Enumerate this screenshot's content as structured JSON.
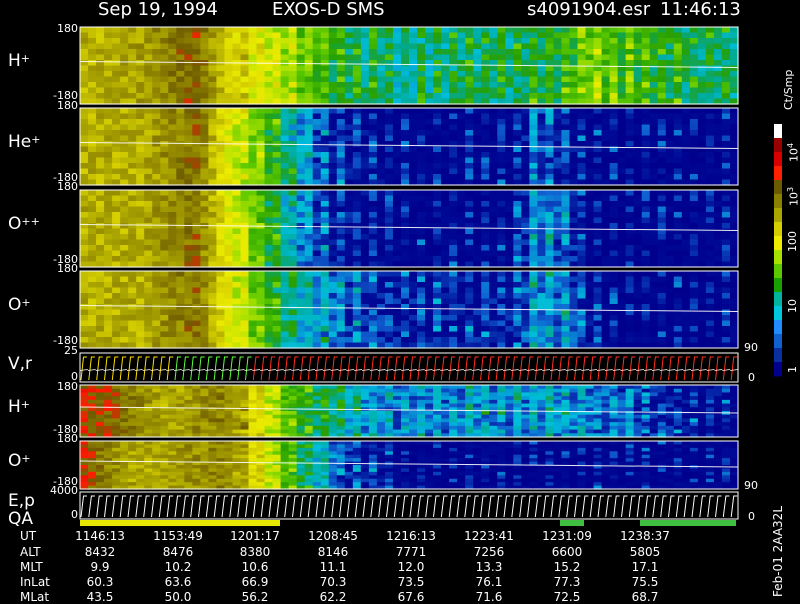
{
  "header": {
    "date": "Sep 19, 1994",
    "instrument": "EXOS-D SMS",
    "file": "s4091904.esr",
    "time": "11:46:13"
  },
  "panels": [
    {
      "id": "h-plus",
      "label": "H",
      "sup": "+",
      "top": "180",
      "bottom": "-180"
    },
    {
      "id": "he-plus",
      "label": "He",
      "sup": "+",
      "top": "180",
      "bottom": "-180"
    },
    {
      "id": "o-plusplus",
      "label": "O",
      "sup": "++",
      "top": "180",
      "bottom": "-180"
    },
    {
      "id": "o-plus",
      "label": "O",
      "sup": "+",
      "top": "180",
      "bottom": "-180"
    },
    {
      "id": "vr",
      "label": "V,r",
      "sup": "",
      "top": "25",
      "bottom": "0"
    },
    {
      "id": "h-plus-2",
      "label": "H",
      "sup": "+",
      "top": "180",
      "bottom": "-180"
    },
    {
      "id": "o-plus-2",
      "label": "O",
      "sup": "+",
      "top": "180",
      "bottom": "-180"
    },
    {
      "id": "ep",
      "label": "E,p",
      "sup": "",
      "top": "4000",
      "bottom": "0"
    }
  ],
  "qa_label": "QA",
  "right_ticks": {
    "vr_top": "90",
    "vr_bottom": "0",
    "ep_top": "90",
    "ep_bottom": "0"
  },
  "colorbar": {
    "unit": "Ct/Smp",
    "labels": [
      {
        "base": "10",
        "exp": "4"
      },
      {
        "base": "10",
        "exp": "3"
      },
      {
        "base": "100",
        "exp": ""
      },
      {
        "base": "10",
        "exp": ""
      },
      {
        "base": "1",
        "exp": ""
      }
    ],
    "colors": [
      "#ffffff",
      "#9a0000",
      "#d80000",
      "#ff2000",
      "#6c5a00",
      "#8c8000",
      "#aca600",
      "#d4d000",
      "#eeee00",
      "#a8e000",
      "#5cc800",
      "#18a000",
      "#00b4a0",
      "#00c8dc",
      "#208cff",
      "#1060d0",
      "#0830a0",
      "#00008c"
    ]
  },
  "table": {
    "labels": [
      "UT",
      "ALT",
      "MLT",
      "InLat",
      "MLat"
    ],
    "columns": [
      [
        "1146:13",
        "8432",
        "9.9",
        "60.3",
        "43.5"
      ],
      [
        "1153:49",
        "8476",
        "10.2",
        "63.6",
        "50.0"
      ],
      [
        "1201:17",
        "8380",
        "10.6",
        "66.9",
        "56.2"
      ],
      [
        "1208:45",
        "8146",
        "11.1",
        "70.3",
        "62.2"
      ],
      [
        "1216:13",
        "7771",
        "12.0",
        "73.5",
        "67.6"
      ],
      [
        "1223:41",
        "7256",
        "13.3",
        "76.1",
        "71.6"
      ],
      [
        "1231:09",
        "6600",
        "15.2",
        "77.3",
        "72.5"
      ],
      [
        "1238:37",
        "5805",
        "17.1",
        "75.5",
        "68.7"
      ]
    ]
  },
  "footer": "Feb-01 2AA32L",
  "chart_data": {
    "type": "heatmap",
    "x_axis": "UT",
    "x_ticks": [
      "1146:13",
      "1153:49",
      "1201:17",
      "1208:45",
      "1216:13",
      "1223:41",
      "1231:09",
      "1238:37"
    ],
    "scale": "log",
    "zlabel": "Ct/Smp",
    "zrange": [
      1,
      10000
    ],
    "series": [
      {
        "name": "H+",
        "ylim": [
          -180,
          180
        ],
        "log10_counts_profile": [
          2.6,
          2.6,
          2.7,
          2.9,
          3.1,
          2.4,
          2.1,
          1.8,
          1.5,
          1.2,
          1.1,
          1.0,
          1.0,
          1.1,
          1.1,
          1.1,
          1.2,
          1.3,
          1.6,
          1.4,
          1.3,
          1.2,
          1.1,
          1.1
        ]
      },
      {
        "name": "He+",
        "ylim": [
          -180,
          180
        ],
        "log10_counts_profile": [
          2.6,
          2.6,
          2.6,
          2.8,
          3.0,
          2.2,
          1.6,
          1.1,
          0.6,
          0.3,
          0.2,
          0.15,
          0.1,
          0.1,
          0.1,
          0.1,
          0.5,
          0.3,
          0.1,
          0.1,
          0.1,
          0.1,
          0.1,
          0.1
        ]
      },
      {
        "name": "O++",
        "ylim": [
          -180,
          180
        ],
        "log10_counts_profile": [
          2.6,
          2.6,
          2.6,
          2.8,
          3.0,
          2.2,
          1.6,
          1.0,
          0.5,
          0.3,
          0.2,
          0.15,
          0.1,
          0.1,
          0.1,
          0.1,
          0.6,
          0.5,
          0.1,
          0.1,
          0.1,
          0.1,
          0.1,
          0.1
        ]
      },
      {
        "name": "O+",
        "ylim": [
          -180,
          180
        ],
        "log10_counts_profile": [
          2.6,
          2.6,
          2.6,
          2.8,
          3.0,
          2.2,
          1.6,
          1.1,
          0.8,
          0.6,
          0.4,
          0.3,
          0.3,
          0.3,
          0.3,
          0.3,
          0.7,
          0.6,
          0.2,
          0.1,
          0.1,
          0.1,
          0.1,
          0.1
        ]
      },
      {
        "name": "H+ (2)",
        "ylim": [
          -180,
          180
        ],
        "log10_counts_profile": [
          3.2,
          3.1,
          2.8,
          2.6,
          2.8,
          2.9,
          2.3,
          1.6,
          1.2,
          1.0,
          0.7,
          0.6,
          0.6,
          0.6,
          0.7,
          0.6,
          0.7,
          0.7,
          0.6,
          0.5,
          0.4,
          0.3,
          0.2,
          0.2
        ]
      },
      {
        "name": "O+ (2)",
        "ylim": [
          -180,
          180
        ],
        "log10_counts_profile": [
          3.2,
          2.8,
          2.6,
          2.7,
          2.8,
          2.9,
          2.3,
          1.6,
          1.0,
          0.5,
          0.3,
          0.2,
          0.1,
          0.1,
          0.1,
          0.1,
          0.1,
          0.1,
          0.1,
          0.1,
          0.1,
          0.1,
          0.1,
          0.1
        ]
      }
    ],
    "line_panels": [
      {
        "name": "V,r",
        "ylim": [
          0,
          25
        ],
        "right_ylim": [
          0,
          90
        ]
      },
      {
        "name": "E,p",
        "ylim": [
          0,
          4000
        ],
        "right_ylim": [
          0,
          90
        ]
      }
    ]
  }
}
